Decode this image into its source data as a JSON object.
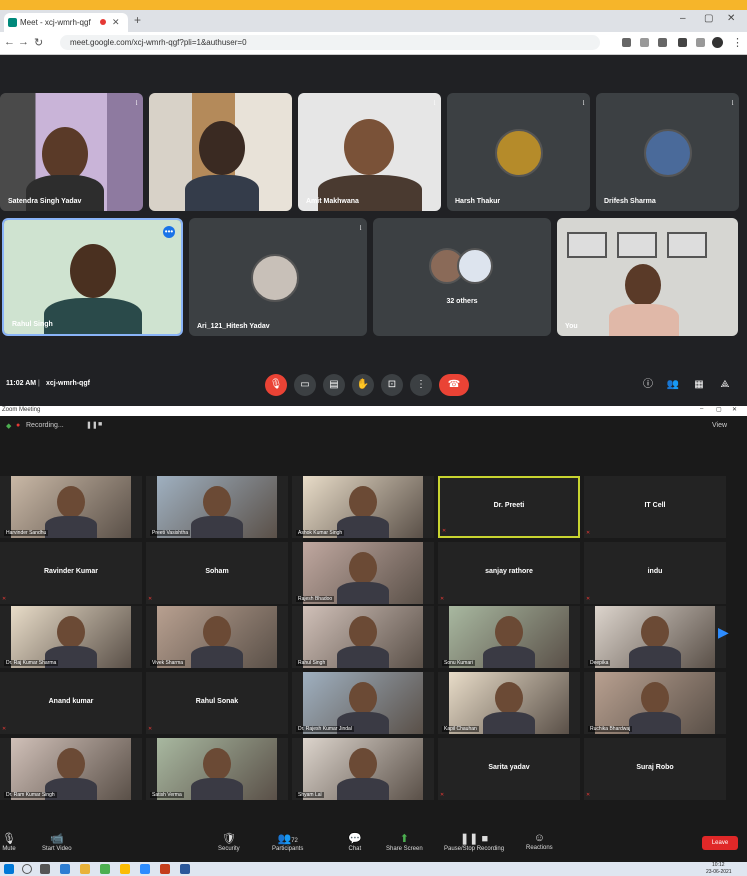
{
  "browser": {
    "tab_title": "Meet - xcj-wmrh-qgf",
    "url": "meet.google.com/xcj-wmrh-qgf?pli=1&authuser=0"
  },
  "meet": {
    "tiles_row1": [
      {
        "name": "Satendra Singh Yadav"
      },
      {
        "name": ""
      },
      {
        "name": "Amit Makhwana"
      },
      {
        "name": "Harsh Thakur"
      },
      {
        "name": "Drifesh Sharma"
      }
    ],
    "tiles_row2": [
      {
        "name": "Rahul Singh"
      },
      {
        "name": "Ari_121_Hitesh Yadav"
      },
      {
        "name": "32 others"
      },
      {
        "name": "You"
      }
    ],
    "time": "11:02 AM",
    "meeting_code": "xcj-wmrh-qgf"
  },
  "zoom": {
    "window_title": "Zoom Meeting",
    "recording": "Recording...",
    "view_label": "View",
    "rows": [
      [
        {
          "name": "",
          "label": "Harvinder Sandhu",
          "video": true
        },
        {
          "name": "",
          "label": "Preeti Vasishtha",
          "video": true
        },
        {
          "name": "",
          "label": "Ashok Kumar Singh",
          "video": true
        },
        {
          "name": "Dr. Preeti",
          "label": "",
          "video": false,
          "active": true
        },
        {
          "name": "IT Cell",
          "label": "",
          "video": false
        }
      ],
      [
        {
          "name": "Ravinder Kumar",
          "label": "",
          "video": false
        },
        {
          "name": "Soham",
          "label": "",
          "video": false
        },
        {
          "name": "",
          "label": "Rajesh Bhadoo",
          "video": true
        },
        {
          "name": "sanjay rathore",
          "label": "",
          "video": false
        },
        {
          "name": "indu",
          "label": "",
          "video": false
        }
      ],
      [
        {
          "name": "",
          "label": "Dr. Raj Kumar Sharma",
          "video": true
        },
        {
          "name": "",
          "label": "Vivek Sharma",
          "video": true
        },
        {
          "name": "",
          "label": "Rahul Singh",
          "video": true
        },
        {
          "name": "",
          "label": "Sonu Kumari",
          "video": true
        },
        {
          "name": "",
          "label": "Deepika",
          "video": true
        }
      ],
      [
        {
          "name": "Anand kumar",
          "label": "",
          "video": false
        },
        {
          "name": "Rahul Sonak",
          "label": "",
          "video": false
        },
        {
          "name": "",
          "label": "Dr. Rajesh Kumar Jindal",
          "video": true
        },
        {
          "name": "",
          "label": "Kapil Chauhan",
          "video": true
        },
        {
          "name": "",
          "label": "Ruchika Bhardwaj",
          "video": true
        }
      ],
      [
        {
          "name": "",
          "label": "Dr. Ram Kumar Singh",
          "video": true
        },
        {
          "name": "",
          "label": "Satish Verma",
          "video": true
        },
        {
          "name": "",
          "label": "Shyam Lal",
          "video": true
        },
        {
          "name": "Sarita yadav",
          "label": "",
          "video": false
        },
        {
          "name": "Suraj Robo",
          "label": "",
          "video": false
        }
      ]
    ],
    "controls": [
      "Mute",
      "Start Video",
      "Security",
      "Participants",
      "Chat",
      "Share Screen",
      "Pause/Stop Recording",
      "Reactions"
    ],
    "participants_count": "72",
    "end_label": "Leave"
  },
  "taskbar": {
    "time": "10:12",
    "date": "23-06-2021"
  },
  "colors": {
    "meet_bg": "#202124",
    "tile_bg": "#3c4043",
    "end_call": "#ea4335",
    "active_border": "#c8d430",
    "zoom_bg": "#1a1a1a"
  }
}
